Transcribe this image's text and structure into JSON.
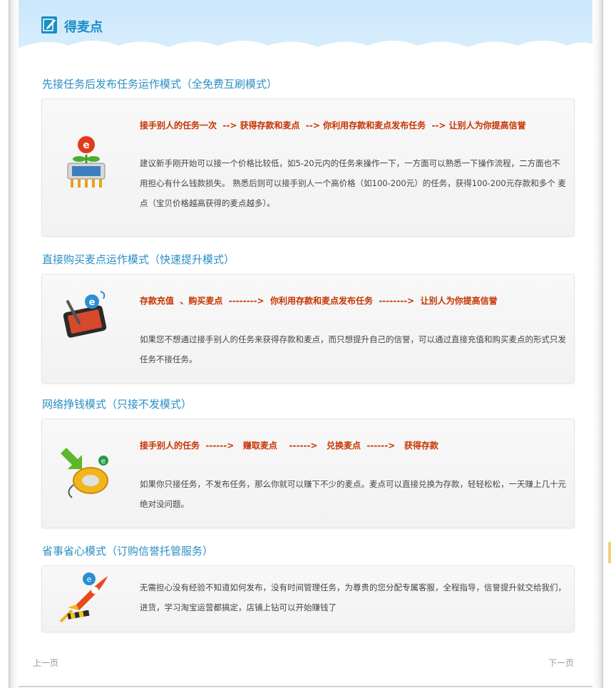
{
  "page": {
    "title": "得麦点",
    "prev_label": "上一页",
    "next_label": "下一页"
  },
  "sections": [
    {
      "heading": "先接任务后发布任务运作模式（全免费互刷模式）",
      "flow": "接手别人的任务一次  --> 获得存款和麦点  --> 你利用存款和麦点发布任务  --> 让别人为你提高信誉",
      "desc": "建议新手刚开始可以接一个价格比较低，如5-20元内的任务来操作一下，一方面可以熟悉一下操作流程，二方面也不用担心有什么钱款损失。 熟悉后则可以接手别人一个高价格（如100-200元）的任务，获得100-200元存款和多个 麦点（宝贝价格越高获得的麦点越多）。",
      "icon": "chip-flower-icon"
    },
    {
      "heading": "直接购买麦点运作模式（快速提升模式）",
      "flow": "存款充值  、购买麦点  -------->  你利用存款和麦点发布任务  -------->  让别人为你提高信誉",
      "desc": "如果您不想通过接手别人的任务来获得存款和麦点，而只想提升自己的信誉，可以通过直接充值和购买麦点的形式只发任务不接任务。",
      "icon": "tablet-pen-icon"
    },
    {
      "heading": "网络挣钱模式（只接不发模式）",
      "flow": "接手别人的任务  ------>   赚取麦点    ------>   兑换麦点  ------>   获得存款",
      "desc": "如果你只接任务，不发布任务，那么你就可以赚下不少的麦点。麦点可以直接兑换为存款，轻轻松松，一天赚上几十元绝对没问题。",
      "icon": "mouse-download-icon"
    },
    {
      "heading": "省事省心模式（订购信誉托管服务）",
      "flow": "",
      "desc": "无需担心没有经验不知道如何发布，没有时间管理任务，为尊贵的您分配专属客服，全程指导，信誉提升就交给我们，进货，学习淘宝运营都搞定，店铺上钻可以开始赚钱了",
      "icon": "rocket-icon"
    }
  ],
  "colors": {
    "heading": "#2a8fc4",
    "flow": "#c63300",
    "body_text": "#444444",
    "header_bg": "#cbe7fb"
  }
}
